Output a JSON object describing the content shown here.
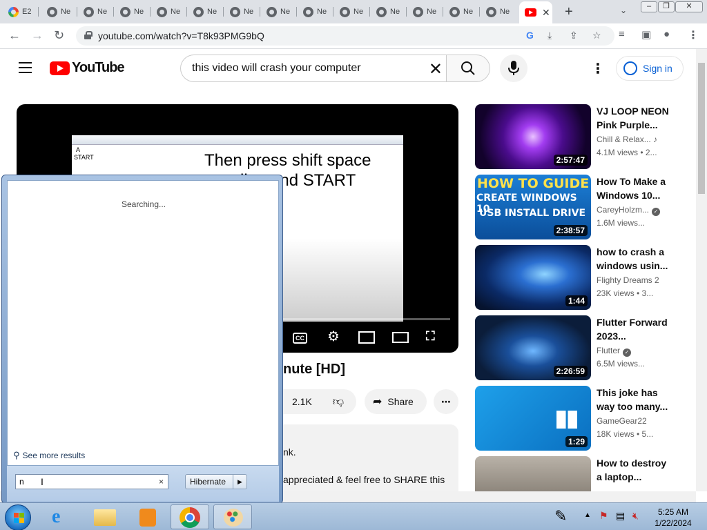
{
  "browser": {
    "tabs": [
      {
        "label": "E2"
      },
      {
        "label": "Ne"
      },
      {
        "label": "Ne"
      },
      {
        "label": "Ne"
      },
      {
        "label": "Ne"
      },
      {
        "label": "Ne"
      },
      {
        "label": "Ne"
      },
      {
        "label": "Ne"
      },
      {
        "label": "Ne"
      },
      {
        "label": "Ne"
      },
      {
        "label": "Ne"
      },
      {
        "label": "Ne"
      },
      {
        "label": "Ne"
      },
      {
        "label": "Ne"
      }
    ],
    "active_tab_close": "✕",
    "new_tab": "+",
    "url": "youtube.com/watch?v=T8k93PMG9bQ"
  },
  "youtube": {
    "logo_text": "YouTube",
    "search": {
      "query": "this video will crash your computer"
    },
    "sign_in": "Sign in",
    "player": {
      "notepad_lines": [
        "A",
        "START"
      ],
      "caption": "Then press shift space next line and START"
    },
    "video_title_visible": "nute [HD]",
    "actions": {
      "likes": "2.1K",
      "share": "Share"
    },
    "description": {
      "line1": "nk.",
      "line2": "appreciated & feel free to SHARE this"
    },
    "recommendations": [
      {
        "title": "VJ LOOP NEON Pink Purple...",
        "channel": "Chill & Relax...",
        "meta": "4.1M views • 2...",
        "duration": "2:57:47"
      },
      {
        "title": "How To Make a Windows 10...",
        "channel": "CareyHolzm...",
        "meta": "1.6M views...",
        "duration": "2:38:57",
        "thumb_line1": "HOW TO GUIDE",
        "thumb_line2": "CREATE WINDOWS 10",
        "thumb_line3": "USB INSTALL DRIVE"
      },
      {
        "title": "how to crash a windows usin...",
        "channel": "Flighty Dreams 2",
        "meta": "23K views • 3...",
        "duration": "1:44"
      },
      {
        "title": "Flutter Forward 2023...",
        "channel": "Flutter",
        "meta": "6.5M views...",
        "duration": "2:26:59"
      },
      {
        "title": "This joke has way too many...",
        "channel": "GameGear22",
        "meta": "18K views • 5...",
        "duration": "1:29"
      },
      {
        "title": "How to destroy a laptop...",
        "channel": "",
        "meta": "",
        "duration": ""
      }
    ]
  },
  "start_menu": {
    "status": "Searching...",
    "see_more": "See more results",
    "search_value": "n",
    "clear": "×",
    "power_button": "Hibernate"
  },
  "taskbar": {
    "time": "5:25 AM",
    "date": "1/22/2024"
  },
  "colors": {
    "youtube_red": "#ff0000",
    "link_blue": "#065fd4",
    "taskbar": "#b7cde4"
  }
}
